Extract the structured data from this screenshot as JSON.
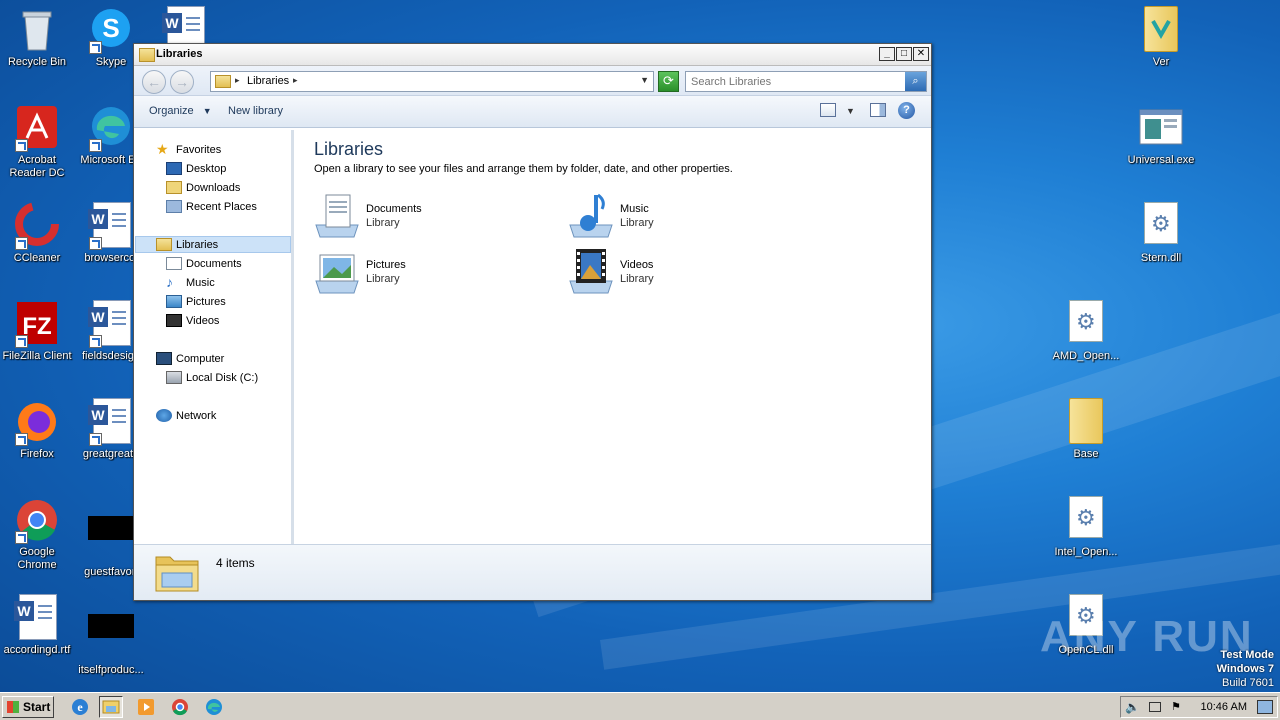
{
  "desktop": {
    "left_icons": [
      {
        "label": "Recycle Bin",
        "icon": "recycle-bin-icon"
      },
      {
        "label": "Skype",
        "icon": "skype-icon"
      },
      {
        "label": "Acrobat Reader DC",
        "icon": "acrobat-icon"
      },
      {
        "label": "Microsoft Ed",
        "icon": "edge-icon"
      },
      {
        "label": "CCleaner",
        "icon": "ccleaner-icon"
      },
      {
        "label": "browsercol",
        "icon": "word-doc-icon"
      },
      {
        "label": "FileZilla Client",
        "icon": "filezilla-icon"
      },
      {
        "label": "fieldsdesign",
        "icon": "word-doc-icon"
      },
      {
        "label": "Firefox",
        "icon": "firefox-icon"
      },
      {
        "label": "greatgreate",
        "icon": "word-doc-icon"
      },
      {
        "label": "Google Chrome",
        "icon": "chrome-icon"
      },
      {
        "label": "guestfavori",
        "icon": "blacked-out-icon"
      },
      {
        "label": "accordingd.rtf",
        "icon": "word-doc-icon"
      },
      {
        "label": "itselfproduc...",
        "icon": "blacked-out-icon"
      }
    ],
    "right_icons": [
      {
        "label": "Ver",
        "icon": "folder-icon"
      },
      {
        "label": "Universal.exe",
        "icon": "exe-icon"
      },
      {
        "label": "Stern.dll",
        "icon": "dll-icon"
      },
      {
        "label": "AMD_Open...",
        "icon": "dll-icon"
      },
      {
        "label": "Base",
        "icon": "folder-icon"
      },
      {
        "label": "Intel_Open...",
        "icon": "dll-icon"
      },
      {
        "label": "OpenCL.dll",
        "icon": "dll-icon"
      }
    ],
    "watermark": {
      "line1": "Test Mode",
      "line2": "Windows 7",
      "line3": "Build 7601"
    },
    "anyrun": "ANY RUN"
  },
  "window": {
    "title": "Libraries",
    "buttons": {
      "minimize": "_",
      "maximize": "□",
      "close": "✕"
    },
    "address": {
      "path": "Libraries"
    },
    "search": {
      "placeholder": "Search Libraries"
    },
    "commands": {
      "organize": "Organize",
      "new_library": "New library"
    },
    "nav": {
      "favorites": "Favorites",
      "desktop": "Desktop",
      "downloads": "Downloads",
      "recent_places": "Recent Places",
      "libraries": "Libraries",
      "documents": "Documents",
      "music": "Music",
      "pictures": "Pictures",
      "videos": "Videos",
      "computer": "Computer",
      "local_disk": "Local Disk (C:)",
      "network": "Network"
    },
    "content": {
      "heading": "Libraries",
      "subtitle": "Open a library to see your files and arrange them by folder, date, and other properties.",
      "libraries": [
        {
          "name": "Documents",
          "type": "Library"
        },
        {
          "name": "Music",
          "type": "Library"
        },
        {
          "name": "Pictures",
          "type": "Library"
        },
        {
          "name": "Videos",
          "type": "Library"
        }
      ]
    },
    "details": {
      "count": "4 items"
    }
  },
  "taskbar": {
    "start": "Start",
    "clock": "10:46 AM"
  }
}
